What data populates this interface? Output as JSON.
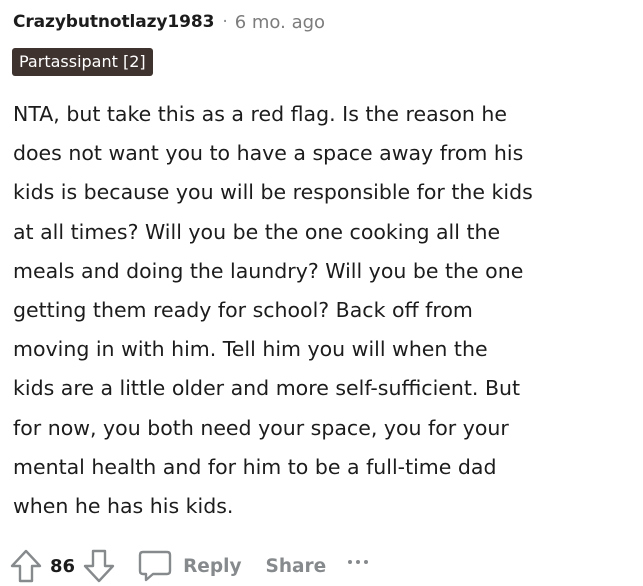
{
  "comment": {
    "author": "Crazybutnotlazy1983",
    "separator": "·",
    "timestamp": "6 mo. ago",
    "flair": "Partassipant [2]",
    "body_lines": [
      "NTA, but take this as a red flag. Is the reason he",
      "does not want you to have a space away from his",
      "kids is because you will be responsible for the kids",
      "at all times? Will you be the one cooking all the",
      "meals and doing the laundry? Will you be the one",
      "getting them ready for school? Back off from",
      "moving in with him. Tell him you will when the",
      "kids are a little older and more self-sufficient. But",
      "for now, you both need your space, you for your",
      "mental health and for him to be a full-time dad",
      "when he has his kids."
    ]
  },
  "actions": {
    "upvote_icon": "upvote-arrow-icon",
    "vote_count": "86",
    "downvote_icon": "downvote-arrow-icon",
    "reply_icon": "speech-bubble-icon",
    "reply_label": "Reply",
    "share_label": "Share",
    "more_icon": "ellipsis-icon"
  },
  "colors": {
    "flair_background": "#3f3330",
    "muted_text": "#878a8c",
    "body_text": "#1c1c1c"
  }
}
